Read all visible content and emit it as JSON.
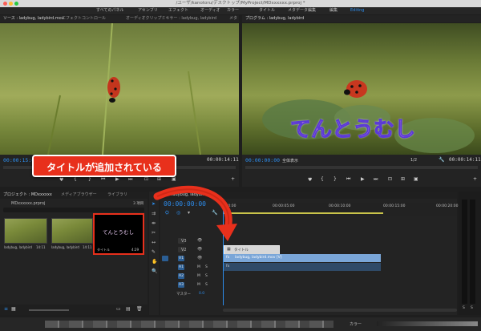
{
  "window": {
    "title": "/ユーザ/kanotoru/デスクトップ/MyProject/MDxxxxxx.prproj *"
  },
  "menu": [
    "すべてのパネル",
    "アセンブリ",
    "エフェクト",
    "オーディオ",
    "カラー",
    "タイトル",
    "メタデータ編集",
    "編集",
    "Editing"
  ],
  "source": {
    "tabs": [
      "ソース : ladybug, ladybird.mov",
      "エフェクトコントロール",
      "オーディオクリップミキサー : ladybug, ladybird",
      "メタ"
    ],
    "timecode": "00:00:15:02",
    "duration": "00:00:14:11"
  },
  "program": {
    "tab": "プログラム : ladybug, ladybird",
    "timecode": "00:00:00:00",
    "fit": "全体表示",
    "ratio": "1/2",
    "duration": "00:00:14:11",
    "overlay_title": "てんとうむし"
  },
  "annotation": {
    "text": "タイトルが追加されている"
  },
  "project": {
    "tabs": [
      "プロジェクト : MDxxxxxx",
      "メディアブラウザー",
      "ライブラリ"
    ],
    "file": "MDxxxxxx.prproj",
    "count": "3 項目",
    "items": [
      {
        "name": "ladybug, ladybird",
        "duration": "14:11"
      },
      {
        "name": "ladybug, ladybird",
        "duration": "14:11"
      },
      {
        "name": "タイトル",
        "duration": "4:29",
        "preview": "てんとうむし"
      }
    ]
  },
  "timeline": {
    "tab": "ladybug, ladybird",
    "timecode": "00:00:00:00",
    "ruler": [
      ":00:00",
      "00:00:05:00",
      "00:00:10:00",
      "00:00:15:00",
      "00:00:20:00"
    ],
    "tracks": [
      "V3",
      "V2",
      "V1",
      "A1",
      "A2",
      "A3"
    ],
    "master": "マスター",
    "master_value": "0.0",
    "clip_title": "タイトル",
    "clip_video": "ladybug, ladybird.mov [V]",
    "toggle_m": "M",
    "toggle_s": "S",
    "fx_label": "fx"
  },
  "meter": {
    "labels": [
      "S",
      "S"
    ]
  },
  "status": {
    "label": "カラー"
  },
  "colors": {
    "accent": "#2d8ceb",
    "annotation": "#e8301c",
    "highlight": "#e8301c"
  }
}
